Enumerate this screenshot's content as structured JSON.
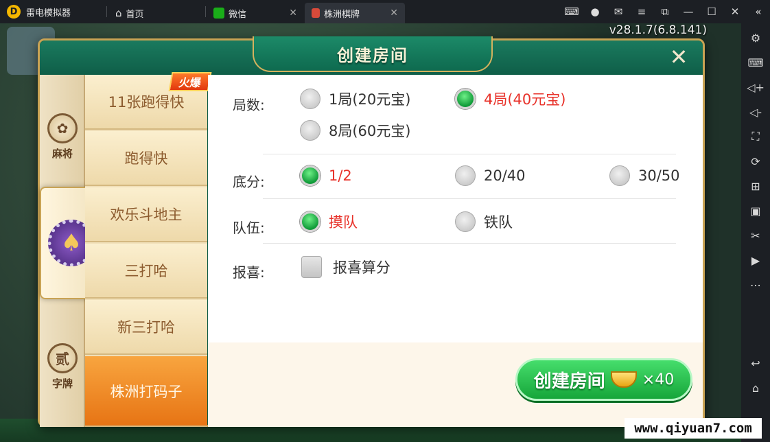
{
  "titlebar": {
    "brand": "雷电模拟器",
    "tabs": [
      {
        "label": "首页"
      },
      {
        "label": "微信"
      },
      {
        "label": "株洲棋牌"
      }
    ]
  },
  "game": {
    "version": "v28.1.7(6.8.141)"
  },
  "dialog": {
    "title": "创建房间",
    "categories": [
      {
        "label": "麻将",
        "icon": "mahjong-icon"
      },
      {
        "label": "",
        "icon": "spade-chip-icon"
      },
      {
        "label": "字牌",
        "icon": "zipai-icon",
        "badge": "贰"
      }
    ],
    "games": [
      {
        "label": "11张跑得快"
      },
      {
        "label": "跑得快"
      },
      {
        "label": "欢乐斗地主"
      },
      {
        "label": "三打哈"
      },
      {
        "label": "新三打哈"
      },
      {
        "label": "株洲打码子"
      }
    ],
    "hot_badge": "火爆",
    "rows": {
      "rounds": {
        "label": "局数:",
        "options": [
          {
            "text": "1局(20元宝)",
            "selected": false
          },
          {
            "text": "4局(40元宝)",
            "selected": true
          },
          {
            "text": "8局(60元宝)",
            "selected": false
          }
        ]
      },
      "base_score": {
        "label": "底分:",
        "options": [
          {
            "text": "1/2",
            "selected": true
          },
          {
            "text": "20/40",
            "selected": false
          },
          {
            "text": "30/50",
            "selected": false
          }
        ]
      },
      "team": {
        "label": "队伍:",
        "options": [
          {
            "text": "摸队",
            "selected": true
          },
          {
            "text": "铁队",
            "selected": false
          }
        ]
      },
      "baoxi": {
        "label": "报喜:",
        "checkbox_text": "报喜算分",
        "checked": false
      }
    },
    "create_button": {
      "label": "创建房间",
      "cost": "×40"
    }
  },
  "watermark": "www.qiyuan7.com",
  "colors": {
    "selected_text": "#e8322a",
    "radio_on": "#16a63a",
    "dialog_green": "#0c5a45",
    "game_selected": "#e77414"
  }
}
